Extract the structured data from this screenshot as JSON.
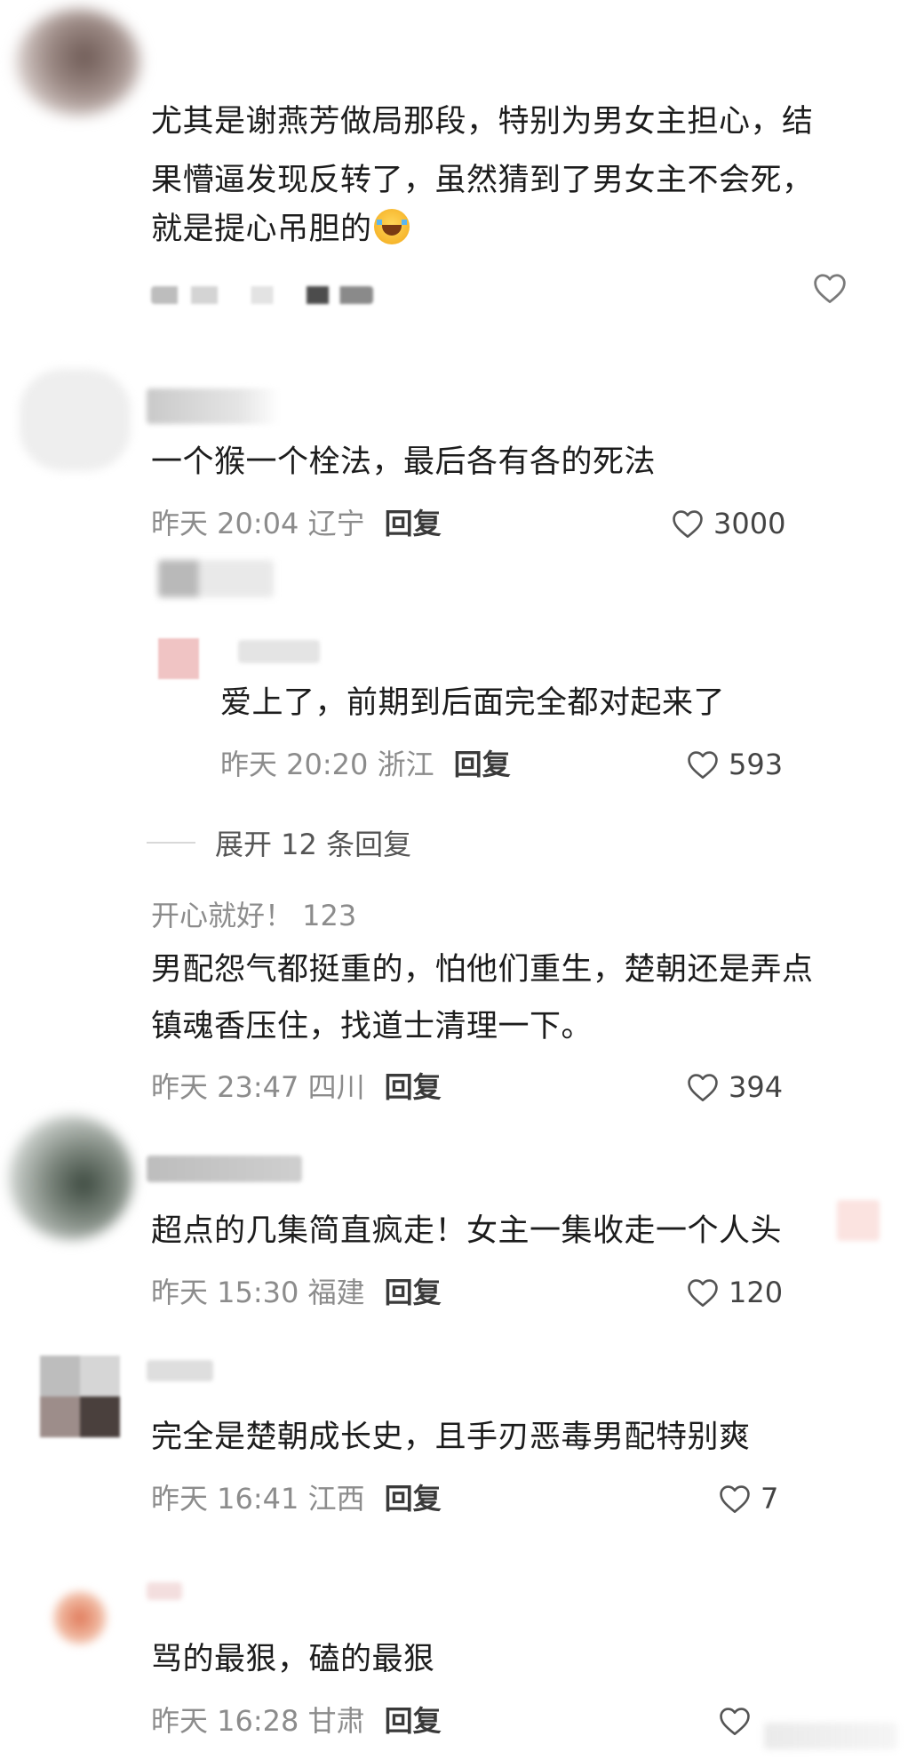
{
  "comments": [
    {
      "lines": [
        "尤其是谢燕芳做局那段，特别为男女主担心，结",
        "果懵逼发现反转了，虽然猜到了男女主不会死，",
        "就是提心吊胆的"
      ],
      "emoji": "laughing-crying-emoji"
    },
    {
      "text": "一个猴一个栓法，最后各有各的死法",
      "time": "昨天 20:04 辽宁",
      "reply_label": "回复",
      "likes": "3000"
    },
    {
      "text": "爱上了，前期到后面完全都对起来了",
      "time": "昨天 20:20 浙江",
      "reply_label": "回复",
      "likes": "593"
    },
    {
      "username": "开心就好！ 123",
      "lines": [
        "男配怨气都挺重的，怕他们重生，楚朝还是弄点",
        "镇魂香压住，找道士清理一下。"
      ],
      "time": "昨天 23:47 四川",
      "reply_label": "回复",
      "likes": "394"
    },
    {
      "text": "超点的几集简直疯走！女主一集收走一个人头",
      "time": "昨天 15:30 福建",
      "reply_label": "回复",
      "likes": "120"
    },
    {
      "text": "完全是楚朝成长史，且手刃恶毒男配特别爽",
      "time": "昨天 16:41 江西",
      "reply_label": "回复",
      "likes": "7"
    },
    {
      "text": "骂的最狠，磕的最狠",
      "time": "昨天 16:28 甘肃",
      "reply_label": "回复",
      "likes": ""
    }
  ],
  "expand_replies": "展开 12 条回复",
  "icons": {
    "like": "heart-outline-icon"
  },
  "colors": {
    "text": "#1c1c1c",
    "meta": "#8c8c8c",
    "reply": "#3a3a3a"
  }
}
